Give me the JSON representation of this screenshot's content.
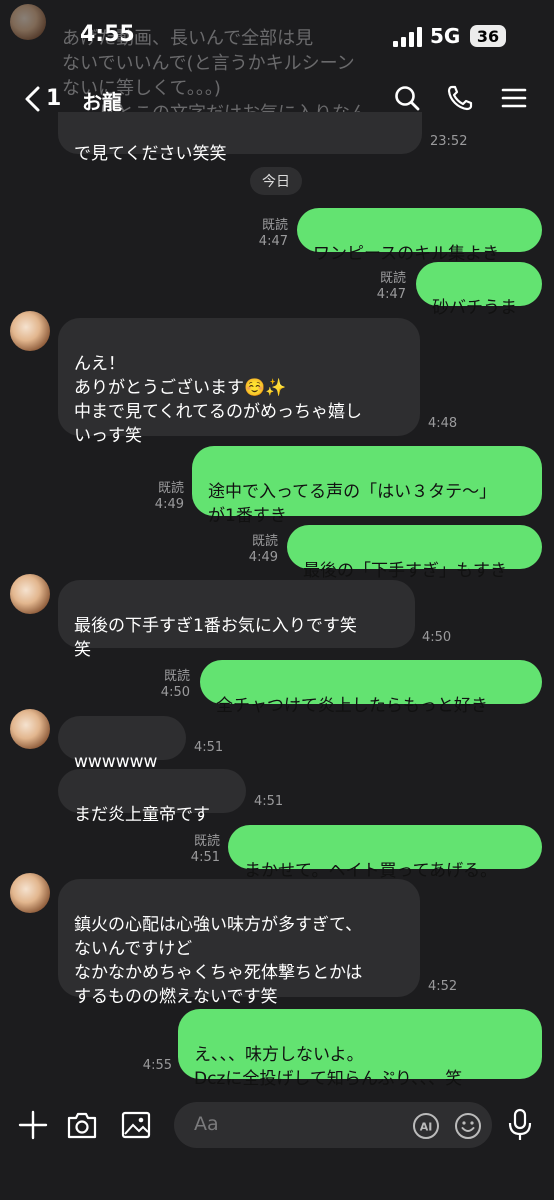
{
  "status_bar": {
    "time": "4:55",
    "network": "5G",
    "battery": "36"
  },
  "header": {
    "unread_count": "1",
    "title": "お龍"
  },
  "prev_message": {
    "faded_lines": [
      "あげた動画、長いんで全部は見",
      "ないでいいんで(と言うかキルシーン",
      "ないに等しくて。。。)",
      "　　りとこの文字だけお気に入りなん"
    ],
    "last_line": "で見てください笑笑",
    "time": "23:52"
  },
  "day_label": "今日",
  "read_label": "既読",
  "messages": [
    {
      "side": "out",
      "text": "ワンピースのキル集よき",
      "time": "4:47"
    },
    {
      "side": "out",
      "text": "砂バチうま",
      "time": "4:47"
    },
    {
      "side": "in",
      "text": "んえ！\nありがとうございます☺️✨\n中まで見てくれてるのがめっちゃ嬉し\nいっす笑",
      "time": "4:48"
    },
    {
      "side": "out",
      "text": "途中で入ってる声の「はい３タテ〜」\nが1番すき",
      "time": "4:49"
    },
    {
      "side": "out",
      "text": "最後の「下手すぎ」もすき",
      "time": "4:49"
    },
    {
      "side": "in",
      "text": "最後の下手すぎ1番お気に入りです笑\n笑",
      "time": "4:50"
    },
    {
      "side": "out",
      "text": "全チャつけて炎上したらもっと好き",
      "time": "4:50"
    },
    {
      "side": "in",
      "text": "wwwwww",
      "time": "4:51"
    },
    {
      "side": "in",
      "text": "まだ炎上童帝です",
      "time": "4:51"
    },
    {
      "side": "out",
      "text": "まかせて。ヘイト買ってあげる。",
      "time": "4:51"
    },
    {
      "side": "in",
      "text": "鎮火の心配は心強い味方が多すぎて、\nないんですけど\nなかなかめちゃくちゃ死体撃ちとかは\nするものの燃えないです笑",
      "time": "4:52"
    },
    {
      "side": "out",
      "text": "え、、、味方しないよ。\nDczに全投げして知らんぷり、、、笑",
      "time": "4:55"
    }
  ],
  "composer": {
    "placeholder": "Aa",
    "ai_label": "AI"
  },
  "colors": {
    "background": "#1c1c1e",
    "incoming": "#2e2e30",
    "outgoing": "#63e371"
  }
}
